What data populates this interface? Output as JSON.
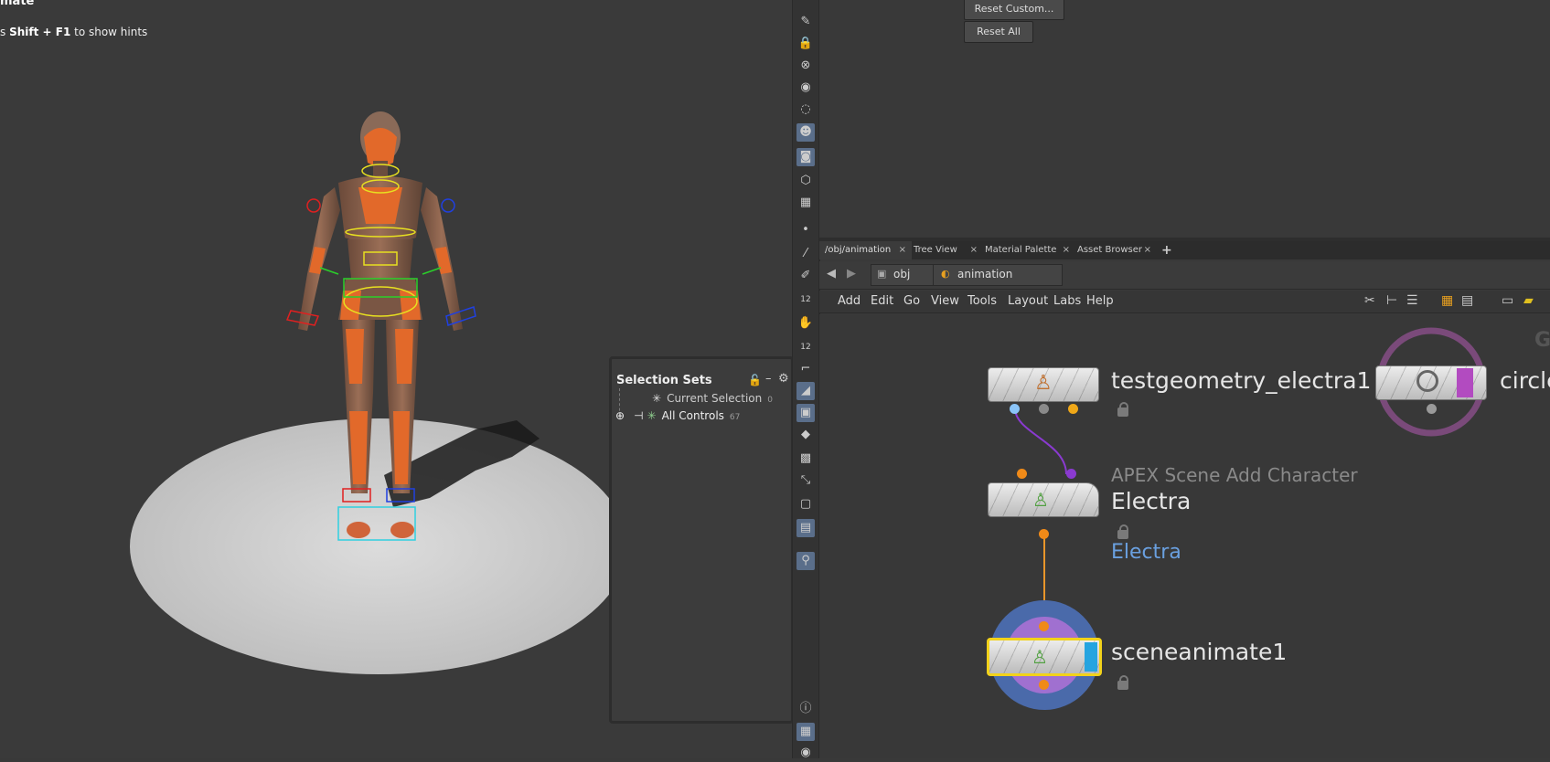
{
  "viewport": {
    "title": "mate",
    "hint_prefix": "s ",
    "hint_key": "Shift + F1",
    "hint_suffix": " to show hints"
  },
  "selection_sets": {
    "title": "Selection Sets",
    "items": [
      {
        "label": "Current Selection",
        "count": "0"
      },
      {
        "label": "All Controls",
        "count": "67"
      }
    ]
  },
  "params": {
    "reset_custom": "Reset Custom...",
    "reset_all": "Reset All"
  },
  "tabs": [
    {
      "label": "/obj/animation"
    },
    {
      "label": "Tree View"
    },
    {
      "label": "Material Palette"
    },
    {
      "label": "Asset Browser"
    }
  ],
  "tab_add": "+",
  "tab_close": "×",
  "path": {
    "root": "obj",
    "current": "animation"
  },
  "menu": [
    "Add",
    "Edit",
    "Go",
    "View",
    "Tools",
    "Layout",
    "Labs",
    "Help"
  ],
  "nodes": {
    "testgeometry": {
      "name": "testgeometry_electra1"
    },
    "circle": {
      "name": "circle"
    },
    "electra": {
      "type_label": "APEX Scene Add Character",
      "name": "Electra",
      "comment": "Electra"
    },
    "sceneanimate": {
      "name": "sceneanimate1"
    },
    "corner_letter": "G"
  },
  "colors": {
    "selected_node_outline": "#f2d21a",
    "wire_purple": "#8a3ad0",
    "wire_orange": "#e8952a",
    "electra_comment": "#6aa0e0",
    "display_flag": "#25a4e0",
    "template_flag": "#b24bc0"
  },
  "icons": [
    "lock-icon",
    "gear-icon",
    "back-arrow-icon",
    "forward-arrow-icon",
    "plus-icon",
    "wrench-icon",
    "list-icon",
    "palette-icon",
    "info-icon"
  ]
}
